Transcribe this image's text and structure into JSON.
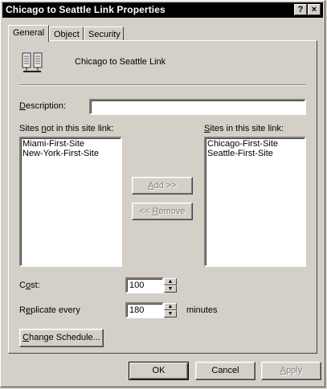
{
  "window": {
    "title": "Chicago to Seattle Link Properties",
    "help_label": "?",
    "close_label": "×"
  },
  "tabs": [
    {
      "label": "General",
      "active": true
    },
    {
      "label": "Object",
      "active": false
    },
    {
      "label": "Security",
      "active": false
    }
  ],
  "general": {
    "link_name": "Chicago to Seattle Link",
    "icon": "site-link-icon",
    "description": {
      "label_prefix": "",
      "label_u": "D",
      "label_rest": "escription:",
      "value": ""
    },
    "sites_not_in": {
      "label_pre": "Sites ",
      "label_u": "n",
      "label_rest": "ot in this site link:",
      "items": [
        "Miami-First-Site",
        "New-York-First-Site"
      ]
    },
    "sites_in": {
      "label_u": "S",
      "label_rest": "ites in this site link:",
      "items": [
        "Chicago-First-Site",
        "Seattle-First-Site"
      ]
    },
    "add_label_u": "A",
    "add_label_rest": "dd >>",
    "remove_label_pre": "<< ",
    "remove_label_u": "R",
    "remove_label_rest": "emove",
    "cost": {
      "label_pre": "C",
      "label_u": "o",
      "label_rest": "st:",
      "value": "100"
    },
    "replicate": {
      "label_pre": "R",
      "label_u": "e",
      "label_rest": "plicate every",
      "value": "180",
      "unit": "minutes"
    },
    "change_schedule": {
      "label_u": "C",
      "label_rest": "hange Schedule..."
    }
  },
  "footer": {
    "ok": "OK",
    "cancel": "Cancel",
    "apply_u": "A",
    "apply_rest": "pply"
  },
  "colors": {
    "face": "#d4d0c8",
    "titlebar": "#000000",
    "disabled_text": "#808080"
  }
}
